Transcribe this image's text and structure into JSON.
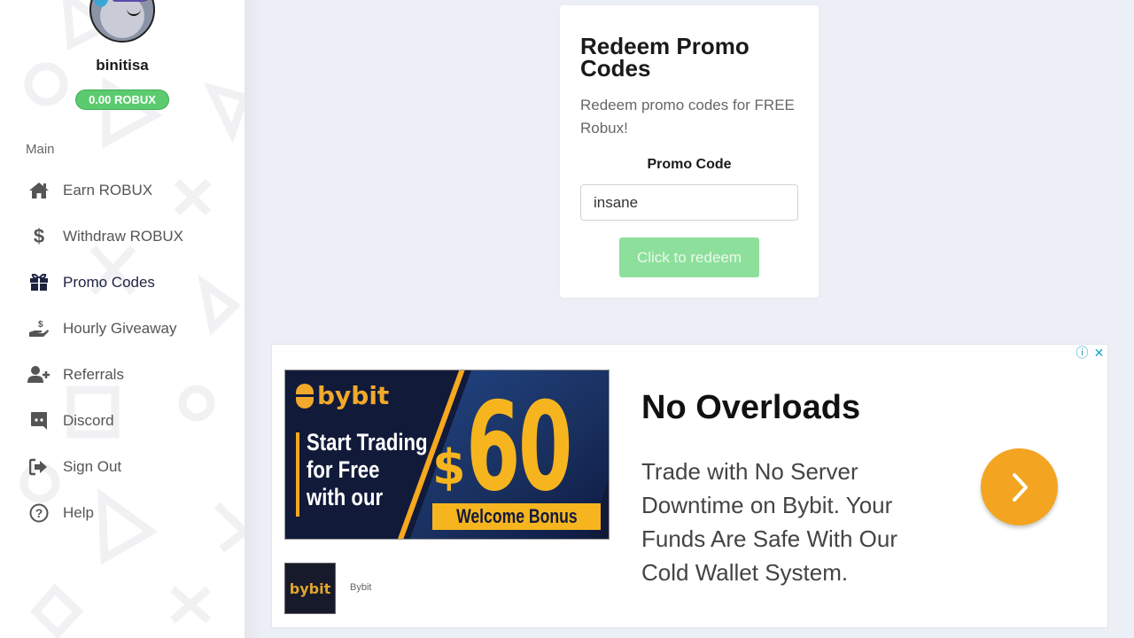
{
  "user": {
    "username": "binitisa",
    "balance": "0.00 ROBUX"
  },
  "sidebar": {
    "section_label": "Main",
    "items": [
      {
        "label": "Earn ROBUX",
        "icon": "home-icon",
        "active": false
      },
      {
        "label": "Withdraw ROBUX",
        "icon": "dollar-icon",
        "active": false
      },
      {
        "label": "Promo Codes",
        "icon": "gift-icon",
        "active": true
      },
      {
        "label": "Hourly Giveaway",
        "icon": "hand-dollar-icon",
        "active": false
      },
      {
        "label": "Referrals",
        "icon": "user-plus-icon",
        "active": false
      },
      {
        "label": "Discord",
        "icon": "discord-icon",
        "active": false
      },
      {
        "label": "Sign Out",
        "icon": "sign-out-icon",
        "active": false
      },
      {
        "label": "Help",
        "icon": "question-circle-icon",
        "active": false
      }
    ]
  },
  "promo": {
    "title": "Redeem Promo Codes",
    "description": "Redeem promo codes for FREE Robux!",
    "field_label": "Promo Code",
    "input_value": "insane",
    "button_label": "Click to redeem"
  },
  "ad": {
    "info_icon": "ⓘ",
    "close_icon": "✕",
    "banner": {
      "brand": "bybit",
      "tagline": [
        "Start Trading",
        "for Free",
        "with our"
      ],
      "currency": "$",
      "amount": "60",
      "bonus": "Welcome Bonus"
    },
    "thumb_brand": "bybit",
    "advertiser": "Bybit",
    "headline": "No Overloads",
    "body": "Trade with No Server Downtime on Bybit. Your Funds Are Safe With Our Cold Wallet System.",
    "colors": {
      "accent": "#f3a521",
      "controls": "#19a4c4"
    }
  },
  "colors": {
    "balance_badge": "#5ccb6f",
    "redeem_button": "#8de09b",
    "page_background": "#eceff6"
  }
}
